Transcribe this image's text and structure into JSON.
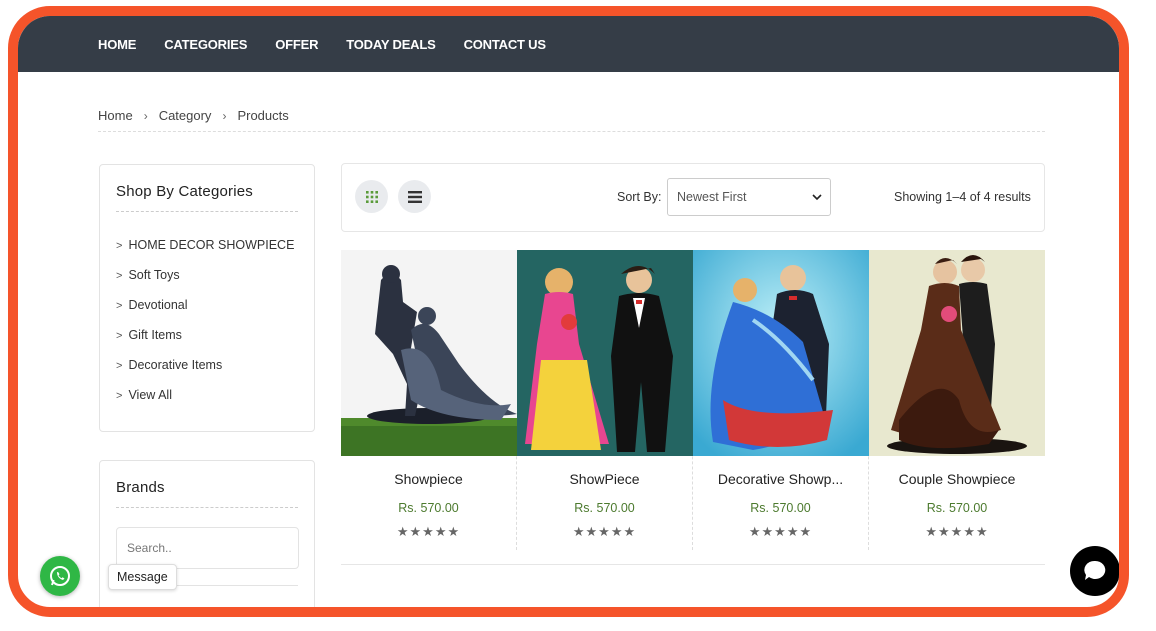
{
  "nav": {
    "items": [
      {
        "label": "HOME"
      },
      {
        "label": "CATEGORIES"
      },
      {
        "label": "OFFER"
      },
      {
        "label": "TODAY DEALS"
      },
      {
        "label": "CONTACT US"
      }
    ]
  },
  "breadcrumb": {
    "items": [
      "Home",
      "Category",
      "Products"
    ],
    "separator": "›"
  },
  "sidebar": {
    "categories": {
      "title": "Shop By Categories",
      "items": [
        {
          "label": "HOME DECOR SHOWPIECE"
        },
        {
          "label": "Soft Toys"
        },
        {
          "label": "Devotional"
        },
        {
          "label": "Gift Items"
        },
        {
          "label": "Decorative Items"
        },
        {
          "label": "View All"
        }
      ]
    },
    "brands": {
      "title": "Brands",
      "search_placeholder": "Search.."
    }
  },
  "toolbar": {
    "sort_label": "Sort By:",
    "sort_value": "Newest First",
    "result_text": "Showing 1–4 of 4 results"
  },
  "products": [
    {
      "name": "Showpiece",
      "price": "Rs. 570.00",
      "rating": 5,
      "image": "dark-couple-figurine"
    },
    {
      "name": "ShowPiece",
      "price": "Rs. 570.00",
      "rating": 5,
      "image": "bride-groom-figurine"
    },
    {
      "name": "Decorative Showp...",
      "price": "Rs. 570.00",
      "rating": 5,
      "image": "carry-couple-figurine"
    },
    {
      "name": "Couple Showpiece",
      "price": "Rs. 570.00",
      "rating": 5,
      "image": "couple-brown-gown-figurine"
    }
  ],
  "whatsapp": {
    "tooltip": "Message"
  },
  "colors": {
    "nav_bg": "#353d47",
    "frame_border": "#f5542a",
    "price": "#4c7a2e",
    "whatsapp": "#2fb745"
  }
}
